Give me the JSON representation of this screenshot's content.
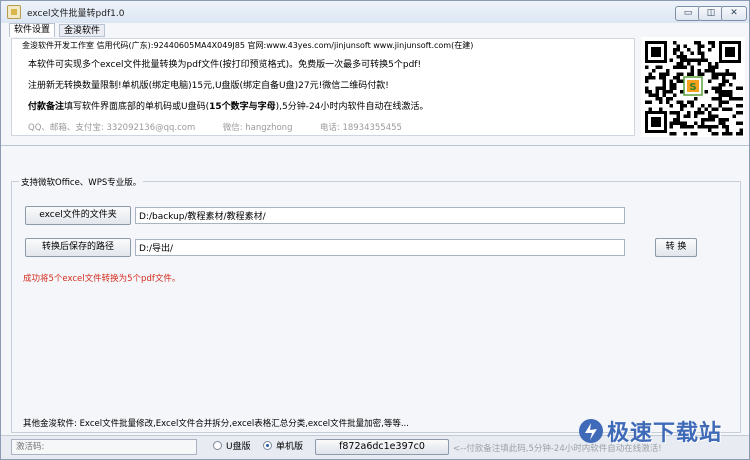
{
  "window": {
    "title": "excel文件批量转pdf1.0",
    "minimize_icon": "minimize-icon",
    "restore_icon": "restore-icon",
    "close_icon": "close-icon"
  },
  "tabs": [
    {
      "label": "软件设置"
    },
    {
      "label": "金浚软件"
    }
  ],
  "info": {
    "header": "金浚软件开发工作室 信用代码(广东):92440605MA4X049J85 官网:www.43yes.com/jinjunsoft  www.jinjunsoft.com(在建)",
    "line1": "本软件可实现多个excel文件批量转换为pdf文件(按打印预览格式)。免费版一次最多可转换5个pdf!",
    "line2": "注册新无转换数量限制!单机版(绑定电脑)15元,U盘版(绑定自备U盘)27元!微信二维码付款!",
    "line3_bold": "付款备注",
    "line3_mid": "填写软件界面底部的单机码或U盘码(",
    "line3_bold2": "15个数字与字母",
    "line3_end": "),5分钟-24小时内软件自动在线激活。",
    "contact_qq": "QQ、邮箱、支付宝: 332092136@qq.com",
    "contact_wechat": "微信: hangzhong",
    "contact_phone": "电话: 18934355455"
  },
  "qr_icon": "wechat-qr-code",
  "main": {
    "support_label": "支持微软Office、WPS专业版。",
    "source_button": "excel文件的文件夹",
    "source_path": "D:/backup/教程素材/教程素材/",
    "output_button": "转换后保存的路径",
    "output_path": "D:/导出/",
    "convert_button": "转 换",
    "success_message": "成功将5个excel文件转换为5个pdf文件。",
    "other_software": "其他金浚软件: Excel文件批量修改,Excel文件合并拆分,excel表格汇总分类,excel文件批量加密,等等..."
  },
  "status": {
    "activation_placeholder": "激活码:",
    "radio_usb": "U盘版",
    "radio_single": "单机版",
    "selected": "单机版",
    "machine_code": "f872a6dc1e397c0",
    "hint": "<--付款备注填此码,5分钟-24小时内软件自动在线激活!"
  },
  "watermark": {
    "text": "极速下载站",
    "logo_icon": "jisu-logo-icon"
  },
  "colors": {
    "success": "#d52b1e",
    "watermark": "#3f6ab7",
    "accent": "#2b5aa8"
  }
}
